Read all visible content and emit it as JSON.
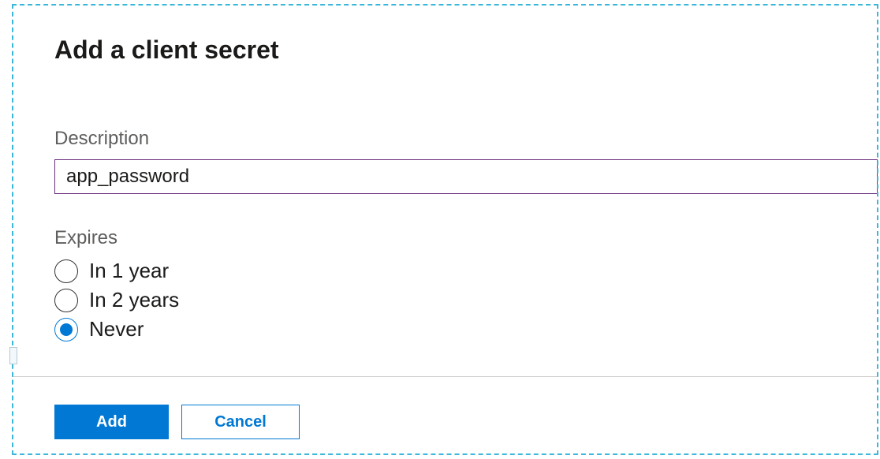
{
  "panel": {
    "title": "Add a client secret",
    "description": {
      "label": "Description",
      "value": "app_password"
    },
    "expires": {
      "label": "Expires",
      "options": [
        {
          "label": "In 1 year",
          "selected": false
        },
        {
          "label": "In 2 years",
          "selected": false
        },
        {
          "label": "Never",
          "selected": true
        }
      ]
    },
    "actions": {
      "add": "Add",
      "cancel": "Cancel"
    }
  },
  "colors": {
    "primary": "#0078d4",
    "input_border": "#6b2e7e",
    "selection": "#3bb8d9"
  }
}
